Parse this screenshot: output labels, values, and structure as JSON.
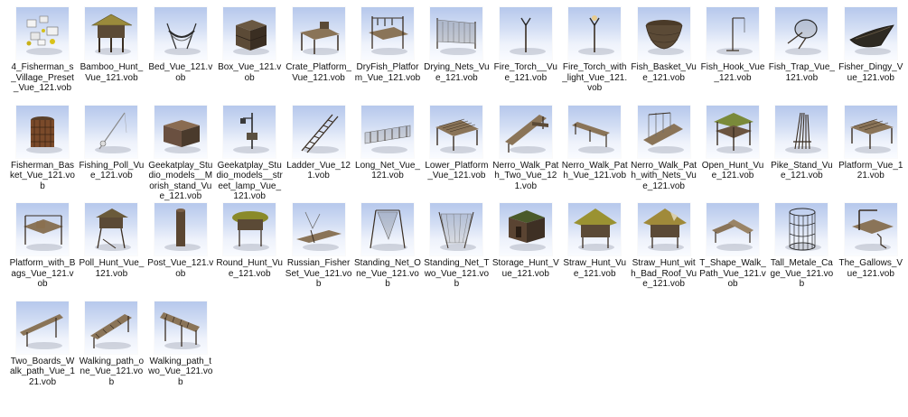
{
  "files": [
    {
      "name": "4_Fisherman_s_Village_Preset_Vue_121.vob",
      "icon": "village-preset-thumbnail"
    },
    {
      "name": "Bamboo_Hunt_Vue_121.vob",
      "icon": "bamboo-hut-thumbnail"
    },
    {
      "name": "Bed_Vue_121.vob",
      "icon": "bed-thumbnail"
    },
    {
      "name": "Box_Vue_121.vob",
      "icon": "box-thumbnail"
    },
    {
      "name": "Crate_Platform_Vue_121.vob",
      "icon": "crate-platform-thumbnail"
    },
    {
      "name": "DryFish_Platform_Vue_121.vob",
      "icon": "dryfish-platform-thumbnail"
    },
    {
      "name": "Drying_Nets_Vue_121.vob",
      "icon": "drying-nets-thumbnail"
    },
    {
      "name": "Fire_Torch__Vue_121.vob",
      "icon": "fire-torch-thumbnail"
    },
    {
      "name": "Fire_Torch_with_light_Vue_121.vob",
      "icon": "fire-torch-light-thumbnail"
    },
    {
      "name": "Fish_Basket_Vue_121.vob",
      "icon": "fish-basket-thumbnail"
    },
    {
      "name": "Fish_Hook_Vue_121.vob",
      "icon": "fish-hook-thumbnail"
    },
    {
      "name": "Fish_Trap_Vue_121.vob",
      "icon": "fish-trap-thumbnail"
    },
    {
      "name": "Fisher_Dingy_Vue_121.vob",
      "icon": "boat-thumbnail"
    },
    {
      "name": "Fisherman_Basket_Vue_121.vob",
      "icon": "basket-thumbnail"
    },
    {
      "name": "Fishing_Poll_Vue_121.vob",
      "icon": "fishing-pole-thumbnail"
    },
    {
      "name": "Geekatplay_Studio_models__Morish_stand_Vue_121.vob",
      "icon": "stand-thumbnail"
    },
    {
      "name": "Geekatplay_Studio_models__street_lamp_Vue_121.vob",
      "icon": "street-lamp-thumbnail"
    },
    {
      "name": "Ladder_Vue_121.vob",
      "icon": "ladder-thumbnail"
    },
    {
      "name": "Long_Net_Vue_121.vob",
      "icon": "long-net-thumbnail"
    },
    {
      "name": "Lower_Platform_Vue_121.vob",
      "icon": "lower-platform-thumbnail"
    },
    {
      "name": "Nerro_Walk_Path_Two_Vue_121.vob",
      "icon": "walk-path-two-thumbnail"
    },
    {
      "name": "Nerro_Walk_Path_Vue_121.vob",
      "icon": "walk-path-thumbnail"
    },
    {
      "name": "Nerro_Walk_Path_with_Nets_Vue_121.vob",
      "icon": "walk-path-nets-thumbnail"
    },
    {
      "name": "Open_Hunt_Vue_121.vob",
      "icon": "open-hut-thumbnail"
    },
    {
      "name": "Pike_Stand_Vue_121.vob",
      "icon": "pike-stand-thumbnail"
    },
    {
      "name": "Platform_Vue_121.vob",
      "icon": "platform-thumbnail"
    },
    {
      "name": "Platform_with_Bags_Vue_121.vob",
      "icon": "platform-bags-thumbnail"
    },
    {
      "name": "Poll_Hunt_Vue_121.vob",
      "icon": "pole-hut-thumbnail"
    },
    {
      "name": "Post_Vue_121.vob",
      "icon": "post-thumbnail"
    },
    {
      "name": "Round_Hunt_Vue_121.vob",
      "icon": "round-hut-thumbnail"
    },
    {
      "name": "Russian_FisherSet_Vue_121.vob",
      "icon": "fisher-set-thumbnail"
    },
    {
      "name": "Standing_Net_One_Vue_121.vob",
      "icon": "standing-net-one-thumbnail"
    },
    {
      "name": "Standing_Net_Two_Vue_121.vob",
      "icon": "standing-net-two-thumbnail"
    },
    {
      "name": "Storage_Hunt_Vue_121.vob",
      "icon": "storage-hut-thumbnail"
    },
    {
      "name": "Straw_Hunt_Vue_121.vob",
      "icon": "straw-hut-thumbnail"
    },
    {
      "name": "Straw_Hunt_with_Bad_Roof_Vue_121.vob",
      "icon": "straw-hut-bad-roof-thumbnail"
    },
    {
      "name": "T_Shape_Walk_Path_Vue_121.vob",
      "icon": "t-shape-path-thumbnail"
    },
    {
      "name": "Tall_Metale_Cage_Vue_121.vob",
      "icon": "metal-cage-thumbnail"
    },
    {
      "name": "The_Gallows_Vue_121.vob",
      "icon": "gallows-thumbnail"
    },
    {
      "name": "Two_Boards_Walk_path_Vue_121.vob",
      "icon": "two-boards-path-thumbnail"
    },
    {
      "name": "Walking_path_one_Vue_121.vob",
      "icon": "walking-path-one-thumbnail"
    },
    {
      "name": "Walking_path_two_Vue_121.vob",
      "icon": "walking-path-two-thumbnail"
    }
  ],
  "colors": {
    "wood_dark": "#3a2e22",
    "wood": "#5b4a36",
    "wood_light": "#8a7458",
    "straw": "#9a8a3c",
    "net": "#6d6d6d",
    "metal": "#2b2b2b"
  }
}
